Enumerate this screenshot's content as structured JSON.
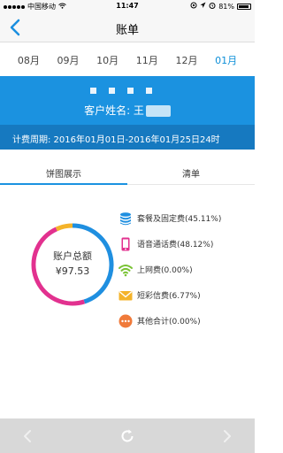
{
  "status": {
    "carrier": "中国移动",
    "time": "11:47",
    "battery": "81%"
  },
  "nav": {
    "title": "账单"
  },
  "months": [
    "08月",
    "09月",
    "10月",
    "11月",
    "12月",
    "01月"
  ],
  "selected_month_index": 5,
  "banner": {
    "customer_label": "客户姓名: ",
    "customer_name_visible": "王"
  },
  "billing_period": "计费周期: 2016年01月01日-2016年01月25日24时",
  "tabs": {
    "chart": "饼图展示",
    "list": "清单"
  },
  "summary": {
    "title": "账户总额",
    "amount": "¥97.53"
  },
  "chart_data": {
    "type": "pie",
    "categories": [
      "套餐及固定费",
      "语音通话费",
      "上网费",
      "短彩信费",
      "其他合计"
    ],
    "values": [
      45.11,
      48.12,
      0.0,
      6.77,
      0.0
    ],
    "colors": [
      "#1f8fe0",
      "#e2318f",
      "#79c233",
      "#f4b32a",
      "#f07a3a"
    ]
  },
  "legend": [
    {
      "label": "套餐及固定费(45.11%)",
      "icon": "coin-stack-icon",
      "color": "#1f8fe0"
    },
    {
      "label": "语音通话费(48.12%)",
      "icon": "mobile-phone-icon",
      "color": "#e2318f"
    },
    {
      "label": "上网费(0.00%)",
      "icon": "wifi-icon",
      "color": "#79c233"
    },
    {
      "label": "短彩信费(6.77%)",
      "icon": "envelope-icon",
      "color": "#f4b32a"
    },
    {
      "label": "其他合计(0.00%)",
      "icon": "more-dots-icon",
      "color": "#f07a3a"
    }
  ]
}
